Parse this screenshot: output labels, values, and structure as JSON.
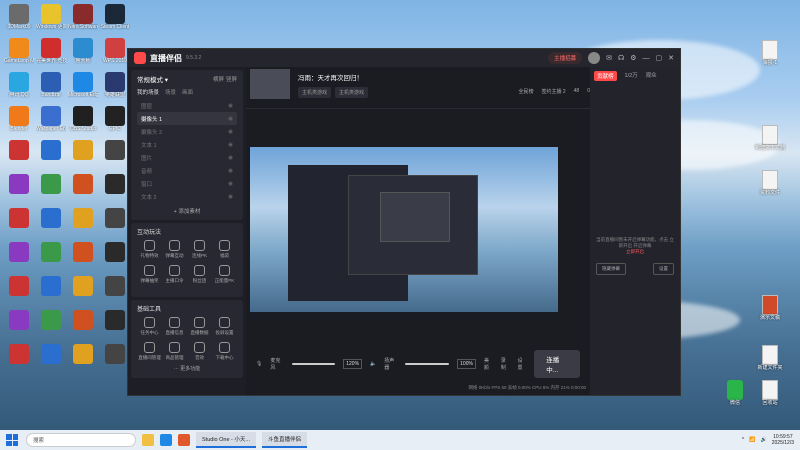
{
  "desktop": {
    "left_icons": [
      {
        "label": "3DMark09",
        "color": "#6b6b6b"
      },
      {
        "label": "Windows 更新助手",
        "color": "#e9c32b"
      },
      {
        "label": "Nitro Software",
        "color": "#8a2b2b"
      },
      {
        "label": "Steam Client",
        "color": "#1b2838"
      },
      {
        "label": "GameLoop Manager",
        "color": "#f08a1a"
      },
      {
        "label": "完美世界 竞技平台",
        "color": "#d02d2d"
      },
      {
        "label": "鲁大师",
        "color": "#2d8bd0"
      },
      {
        "label": "WPS 2019",
        "color": "#d04040"
      },
      {
        "label": "腾讯 QQ",
        "color": "#2aa7e0"
      },
      {
        "label": "Bandizip",
        "color": "#2c5fb3"
      },
      {
        "label": "Microsoft Edge",
        "color": "#1e88e5"
      },
      {
        "label": "英雄联盟",
        "color": "#2a3a6e"
      },
      {
        "label": "Blender",
        "color": "#f07a1a"
      },
      {
        "label": "Wallpaper Engine",
        "color": "#3a6fcf"
      },
      {
        "label": "OBS Studio",
        "color": "#202020"
      },
      {
        "label": "EPIC",
        "color": "#222"
      }
    ],
    "right_icons": [
      {
        "label": "海报-1"
      },
      {
        "label": "新建文本文档"
      },
      {
        "label": "资料文件"
      },
      {
        "label": "演示文稿"
      },
      {
        "label": "新建文件夹"
      },
      {
        "label": "微信"
      },
      {
        "label": "回收站"
      }
    ]
  },
  "app": {
    "name": "直播伴侣",
    "version": "9.5.3.2",
    "title_pill": "主播招募",
    "header_right": [
      "任务",
      "贡献榜",
      "1/2万"
    ],
    "left": {
      "mode": "常规模式 ▾",
      "mode_actions": [
        "横屏",
        "竖屏"
      ],
      "scene_tabs": [
        "我的场景",
        "场景",
        "画面"
      ],
      "sources": [
        {
          "label": "图层",
          "active": false
        },
        {
          "label": "摄像头 1",
          "active": true
        },
        {
          "label": "摄像头 2",
          "active": false
        },
        {
          "label": "文本 1",
          "active": false
        },
        {
          "label": "图片",
          "active": false
        },
        {
          "label": "音频",
          "active": false
        },
        {
          "label": "窗口",
          "active": false
        },
        {
          "label": "文本 2",
          "active": false
        }
      ],
      "add_source": "+ 添加素材",
      "interactive_title": "互动玩法",
      "interactive_tools": [
        "礼物特效",
        "弹幕互动",
        "连线PK",
        "福袋",
        "弹幕抽奖",
        "主播口令",
        "粉丝团",
        "正能量PK"
      ],
      "basic_title": "基础工具",
      "basic_tools": [
        "任务中心",
        "直播信息",
        "直播数据",
        "投屏设置",
        "直播间管理",
        "商品管理",
        "音效",
        "下载中心"
      ],
      "more": "··· 更多功能"
    },
    "stream": {
      "title": "冯雨：天才再次回归！",
      "tags": [
        "主机类游戏",
        "主机类游戏"
      ],
      "stats": [
        "全民榜",
        "签约主播 2",
        "48",
        "0"
      ]
    },
    "right_panel": {
      "tabs": [
        "贡献榜",
        "1/2万",
        "观众"
      ],
      "message": "当前直播间暂未开启弹幕功能，点击 立即开启 开启弹幕",
      "link": "立即开启",
      "buttons": [
        "隐藏弹幕",
        "设置"
      ]
    },
    "bottom": {
      "mic_label": "麦克风",
      "mic_pct": "120%",
      "spk_label": "扬声器",
      "spk_pct": "100%",
      "actions": [
        "美颜",
        "录制",
        "设置"
      ],
      "start_button": "连播中...",
      "status": "网络 0Kb/s  FPS 60  丢帧 0.00%  CPU 6%  内存 21%  0:00:00"
    }
  },
  "taskbar": {
    "search_placeholder": "搜索",
    "tasks": [
      "Studio One - 小天...",
      "斗鱼直播伴侣"
    ],
    "time": "10:59:57",
    "date": "2025/12/3"
  }
}
